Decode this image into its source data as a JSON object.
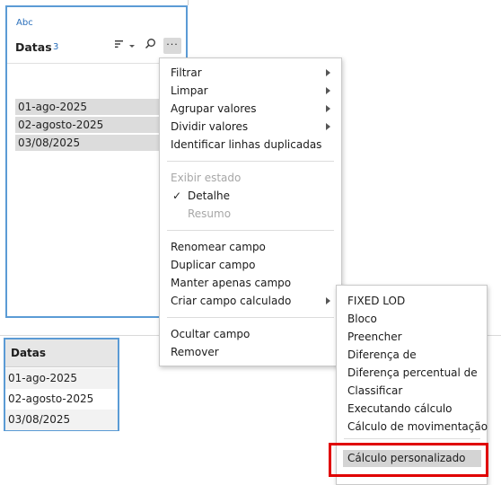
{
  "field_card": {
    "type_label": "Abc",
    "field_name": "Datas",
    "value_count": "3",
    "icons": [
      "sort-icon",
      "dropdown-arrow-icon",
      "search-icon",
      "more-options-icon"
    ],
    "more_label": "···",
    "values": [
      "01-ago-2025",
      "02-agosto-2025",
      "03/08/2025"
    ]
  },
  "grid": {
    "header": "Datas",
    "rows": [
      "01-ago-2025",
      "02-agosto-2025",
      "03/08/2025"
    ]
  },
  "menu": {
    "items": [
      {
        "label": "Filtrar",
        "submenu": true
      },
      {
        "label": "Limpar",
        "submenu": true
      },
      {
        "label": "Agrupar valores",
        "submenu": true
      },
      {
        "label": "Dividir valores",
        "submenu": true
      },
      {
        "label": "Identificar linhas duplicadas",
        "submenu": false
      }
    ],
    "view_state": {
      "header": "Exibir estado",
      "detail": "Detalhe",
      "detail_checked": true,
      "summary": "Resumo"
    },
    "field_items": [
      {
        "label": "Renomear campo",
        "submenu": false
      },
      {
        "label": "Duplicar campo",
        "submenu": false
      },
      {
        "label": "Manter apenas campo",
        "submenu": false
      },
      {
        "label": "Criar campo calculado",
        "submenu": true
      }
    ],
    "hide_items": [
      {
        "label": "Ocultar campo"
      },
      {
        "label": "Remover"
      }
    ]
  },
  "submenu": {
    "items": [
      "FIXED LOD",
      "Bloco",
      "Preencher",
      "Diferença de",
      "Diferença percentual de",
      "Classificar",
      "Executando cálculo",
      "Cálculo de movimentação"
    ],
    "custom": "Cálculo personalizado"
  },
  "colors": {
    "card_border": "#5b9bd5",
    "highlight": "#e00000",
    "selected_bg": "#d4d4d4"
  }
}
